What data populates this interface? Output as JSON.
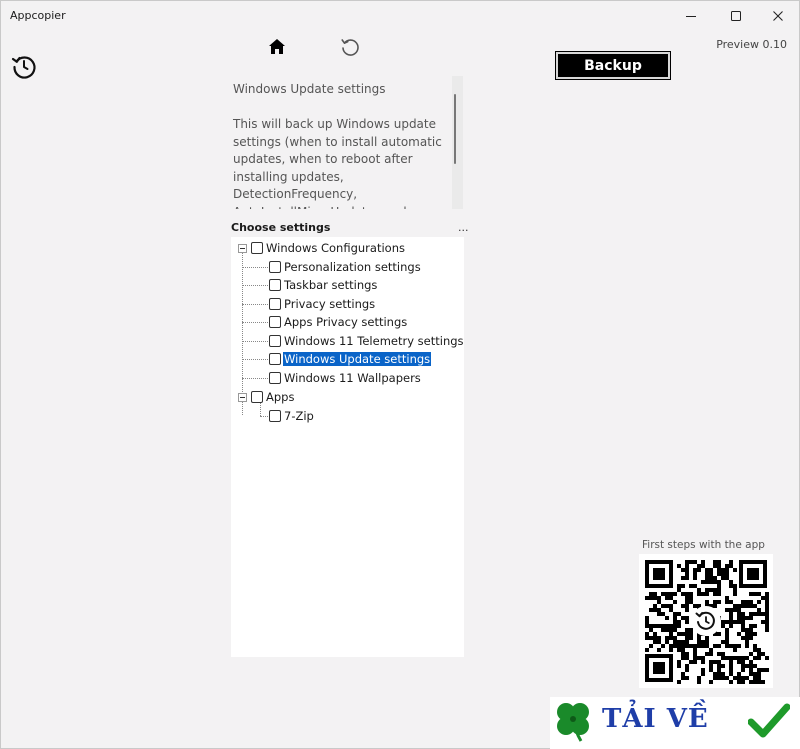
{
  "window": {
    "title": "Appcopier",
    "minimize_icon": "minimize-icon",
    "maximize_icon": "maximize-icon",
    "close_icon": "close-icon"
  },
  "toolbar": {
    "back_icon": "restore-back-icon",
    "home_icon": "home-icon",
    "refresh_icon": "refresh-icon",
    "version": "Preview 0.10",
    "backup_label": "Backup"
  },
  "description": {
    "title": "Windows Update settings",
    "text": "This will back up Windows update settings (when to install automatic updates, when to reboot after installing updates, DetectionFrequency, AutoInstallMinorUpdates and"
  },
  "settings": {
    "label": "Choose settings",
    "more": "...",
    "groups": [
      {
        "label": "Windows Configurations",
        "items": [
          {
            "label": "Personalization settings",
            "checked": false
          },
          {
            "label": "Taskbar settings",
            "checked": false
          },
          {
            "label": "Privacy settings",
            "checked": false
          },
          {
            "label": "Apps Privacy settings",
            "checked": false
          },
          {
            "label": "Windows 11 Telemetry settings",
            "checked": false
          },
          {
            "label": "Windows Update settings",
            "checked": false,
            "selected": true
          },
          {
            "label": "Windows 11 Wallpapers",
            "checked": false
          }
        ]
      },
      {
        "label": "Apps",
        "items": [
          {
            "label": "7-Zip",
            "checked": false
          }
        ]
      }
    ]
  },
  "qr": {
    "caption": "First steps with the app"
  },
  "watermark": {
    "text": "TẢI VỀ",
    "colors": {
      "text": "#1f3ea8",
      "clover": "#1a8a2a",
      "check": "#1e9a2a"
    }
  },
  "colors": {
    "selection": "#0a64c8",
    "window_bg": "#f3f2f3",
    "backup_bg": "#000000"
  }
}
